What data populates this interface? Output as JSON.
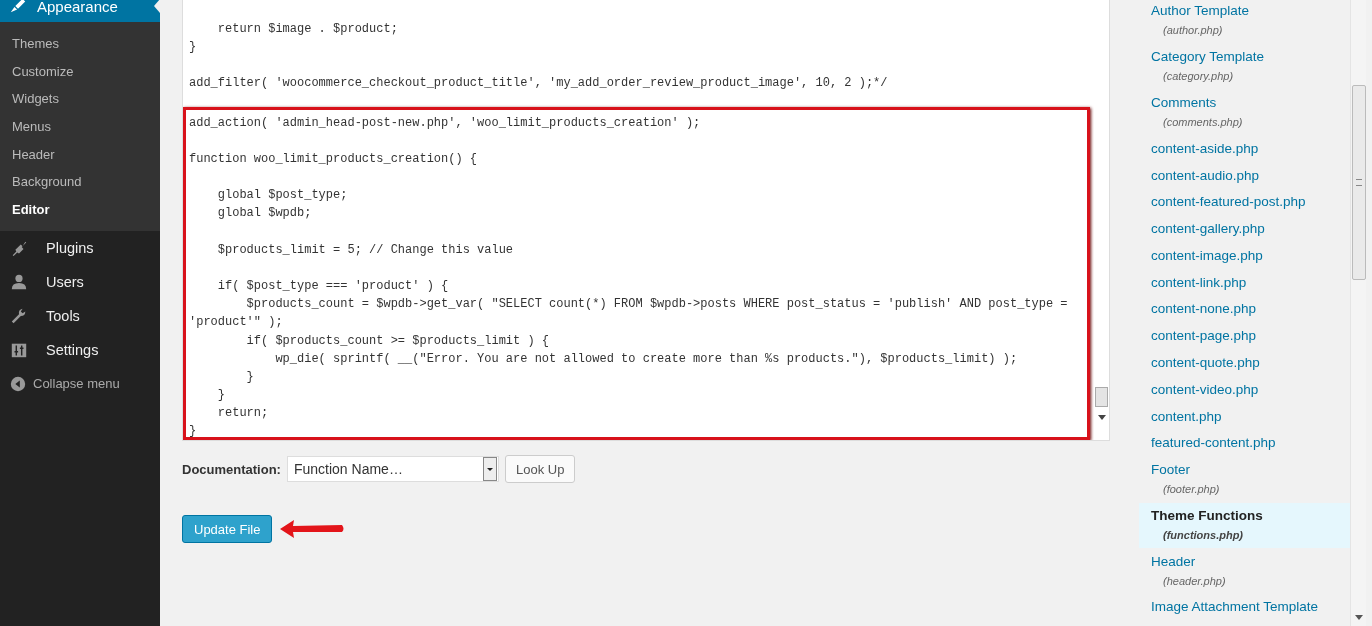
{
  "admin_menu": {
    "current": {
      "label": "Appearance",
      "selected": true
    },
    "submenu": [
      {
        "label": "Themes",
        "selected": false
      },
      {
        "label": "Customize",
        "selected": false
      },
      {
        "label": "Widgets",
        "selected": false
      },
      {
        "label": "Menus",
        "selected": false
      },
      {
        "label": "Header",
        "selected": false
      },
      {
        "label": "Background",
        "selected": false
      },
      {
        "label": "Editor",
        "selected": true
      }
    ],
    "items": [
      {
        "label": "Plugins"
      },
      {
        "label": "Users"
      },
      {
        "label": "Tools"
      },
      {
        "label": "Settings"
      }
    ],
    "collapse": {
      "label": "Collapse menu"
    }
  },
  "editor": {
    "code_before": "    return $image . $product;\n}\n\nadd_filter( 'woocommerce_checkout_product_title', 'my_add_order_review_product_image', 10, 2 );*/",
    "highlighted_code": "add_action( 'admin_head-post-new.php', 'woo_limit_products_creation' );\n\nfunction woo_limit_products_creation() {\n\n    global $post_type;\n    global $wpdb;\n\n    $products_limit = 5; // Change this value\n\n    if( $post_type === 'product' ) {\n        $products_count = $wpdb->get_var( \"SELECT count(*) FROM $wpdb->posts WHERE post_status = 'publish' AND post_type =\n'product'\" );\n        if( $products_count >= $products_limit ) {\n            wp_die( sprintf( __(\"Error. You are not allowed to create more than %s products.\"), $products_limit) );\n        }\n    }\n    return;\n}"
  },
  "documentation": {
    "label": "Documentation:",
    "select_value": "Function Name…",
    "button": "Look Up"
  },
  "update_button": "Update File",
  "files": [
    {
      "name": "Author Template",
      "file": "(author.php)",
      "selected": false
    },
    {
      "name": "Category Template",
      "file": "(category.php)",
      "selected": false
    },
    {
      "name": "Comments",
      "file": "(comments.php)",
      "selected": false
    },
    {
      "name": "content-aside.php",
      "selected": false
    },
    {
      "name": "content-audio.php",
      "selected": false
    },
    {
      "name": "content-featured-post.php",
      "selected": false
    },
    {
      "name": "content-gallery.php",
      "selected": false
    },
    {
      "name": "content-image.php",
      "selected": false
    },
    {
      "name": "content-link.php",
      "selected": false
    },
    {
      "name": "content-none.php",
      "selected": false
    },
    {
      "name": "content-page.php",
      "selected": false
    },
    {
      "name": "content-quote.php",
      "selected": false
    },
    {
      "name": "content-video.php",
      "selected": false
    },
    {
      "name": "content.php",
      "selected": false
    },
    {
      "name": "featured-content.php",
      "selected": false
    },
    {
      "name": "Footer",
      "file": "(footer.php)",
      "selected": false
    },
    {
      "name": "Theme Functions",
      "file": "(functions.php)",
      "selected": true
    },
    {
      "name": "Header",
      "file": "(header.php)",
      "selected": false
    },
    {
      "name": "Image Attachment Template",
      "selected": false
    }
  ]
}
